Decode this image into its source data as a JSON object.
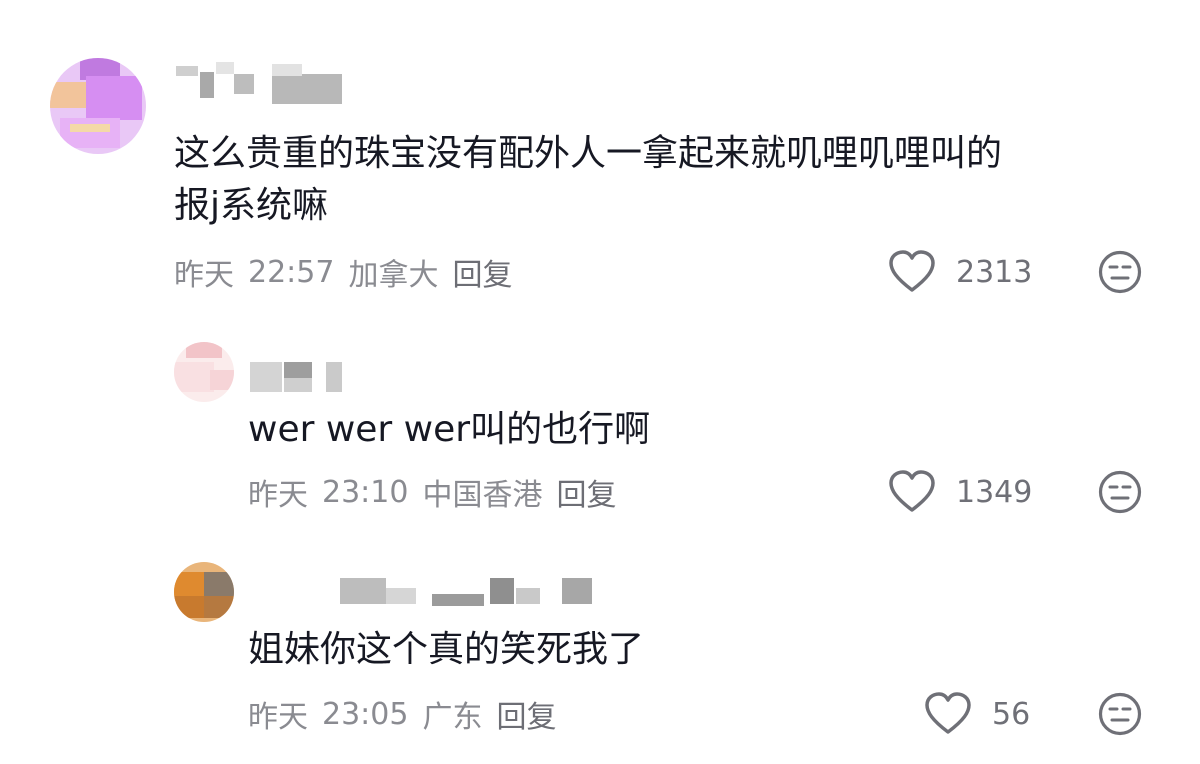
{
  "comments": [
    {
      "text_line1": "这么贵重的珠宝没有配外人一拿起来就叽哩叽哩叫的",
      "text_line2": "报j系统嘛",
      "date": "昨天",
      "time": "22:57",
      "location": "加拿大",
      "reply_label": "回复",
      "likes": "2313",
      "avatar_color": "#d9b0f2"
    },
    {
      "text_line1": "wer wer wer叫的也行啊",
      "date": "昨天",
      "time": "23:10",
      "location": "中国香港",
      "reply_label": "回复",
      "likes": "1349",
      "avatar_color": "#f7dada"
    },
    {
      "text_line1": "姐妹你这个真的笑死我了",
      "date": "昨天",
      "time": "23:05",
      "location": "广东",
      "reply_label": "回复",
      "likes": "56",
      "avatar_color": "#d9893b"
    }
  ],
  "icons": {
    "like": "heart-outline-icon",
    "dislike": "neutral-face-icon"
  }
}
